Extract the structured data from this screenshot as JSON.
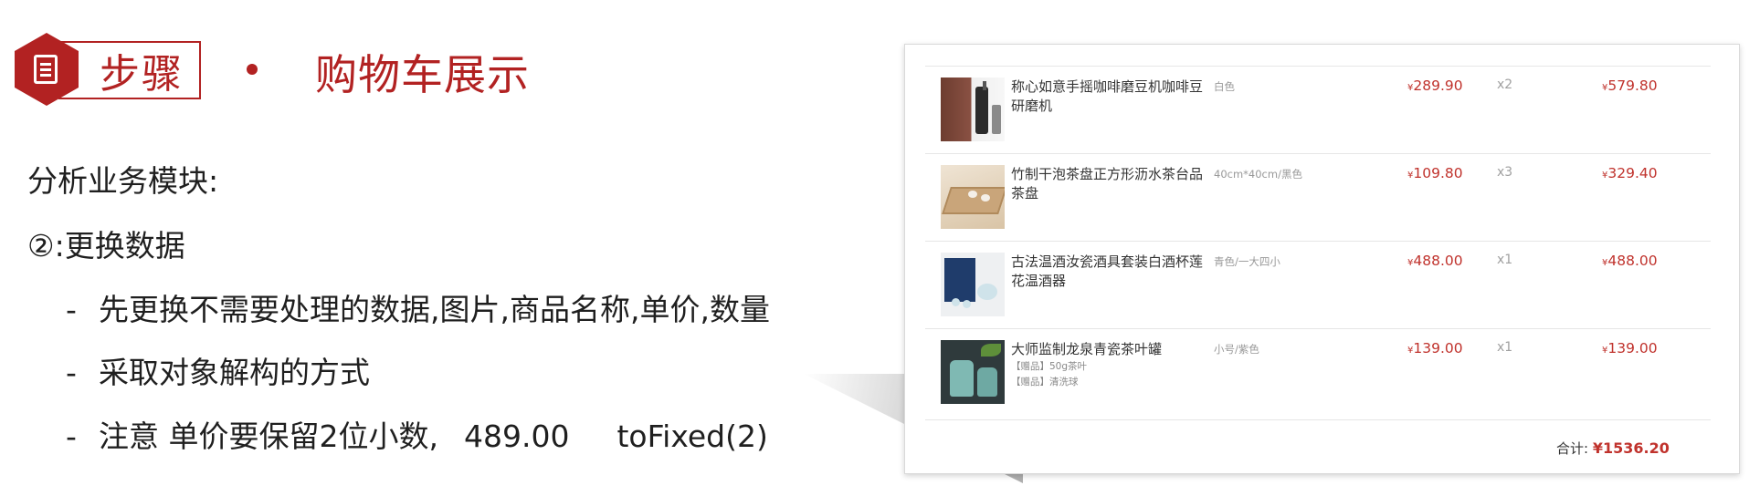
{
  "header": {
    "step_label": "步骤",
    "bullet": "•",
    "title": "购物车展示"
  },
  "content": {
    "line1": "分析业务模块:",
    "line2": "②:更换数据",
    "dash": "-",
    "item1": "先更换不需要处理的数据,图片,商品名称,单价,数量",
    "item2": "采取对象解构的方式",
    "item3_a": "注意 单价要保留2位小数,",
    "item3_b": "489.00",
    "item3_c": "toFixed(2)"
  },
  "cart": {
    "currency": "¥",
    "rows": [
      {
        "name": "称心如意手摇咖啡磨豆机咖啡豆研磨机",
        "spec": "白色",
        "price": "289.90",
        "qty": "x2",
        "subtotal": "579.80"
      },
      {
        "name": "竹制干泡茶盘正方形沥水茶台品茶盘",
        "spec": "40cm*40cm/黑色",
        "price": "109.80",
        "qty": "x3",
        "subtotal": "329.40"
      },
      {
        "name": "古法温酒汝瓷酒具套装白酒杯莲花温酒器",
        "spec": "青色/一大四小",
        "price": "488.00",
        "qty": "x1",
        "subtotal": "488.00"
      },
      {
        "name": "大师监制龙泉青瓷茶叶罐",
        "gifts": [
          "【赠品】50g茶叶",
          "【赠品】清洗球"
        ],
        "spec": "小号/紫色",
        "price": "139.00",
        "qty": "x1",
        "subtotal": "139.00"
      }
    ],
    "total_label": "合计:",
    "total_value": "¥1536.20"
  },
  "colors": {
    "brand_red": "#b22222",
    "price_red": "#c0322c"
  },
  "icons": {
    "step_icon": "document-icon"
  }
}
